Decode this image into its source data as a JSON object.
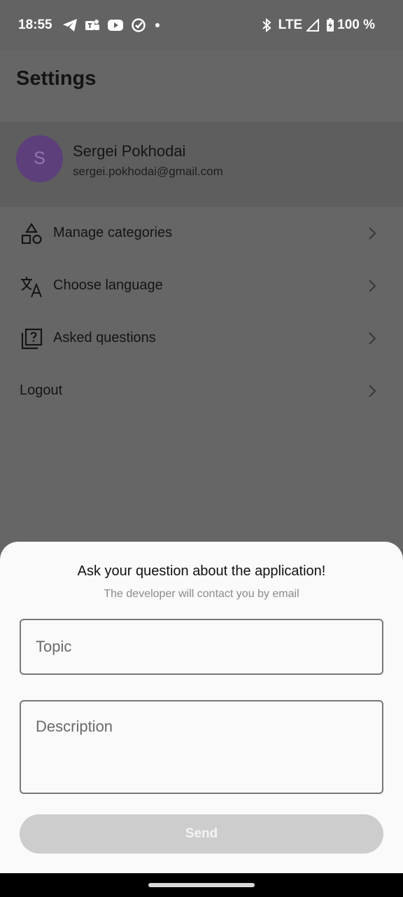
{
  "status_bar": {
    "time": "18:55",
    "notification_icons": [
      "telegram-icon",
      "teams-icon",
      "youtube-icon",
      "tasks-icon",
      "dot-icon"
    ],
    "network": "LTE",
    "battery": "100 %"
  },
  "screen": {
    "title": "Settings"
  },
  "profile": {
    "initial": "S",
    "name": "Sergei Pokhodai",
    "email": "sergei.pokhodai@gmail.com",
    "avatar_color": "#5d3f7c"
  },
  "menu": {
    "items": [
      {
        "label": "Manage categories",
        "icon": "categories-icon"
      },
      {
        "label": "Choose language",
        "icon": "translate-icon"
      },
      {
        "label": "Asked questions",
        "icon": "questions-icon"
      },
      {
        "label": "Logout",
        "icon": ""
      }
    ]
  },
  "sheet": {
    "title": "Ask your question about the application!",
    "subtitle": "The developer will contact you by email",
    "topic_placeholder": "Topic",
    "topic_value": "",
    "description_placeholder": "Description",
    "description_value": "",
    "send_label": "Send"
  },
  "colors": {
    "scrim": "#666666",
    "sheet_background": "#fafafa",
    "send_disabled": "#cdcdcd"
  }
}
